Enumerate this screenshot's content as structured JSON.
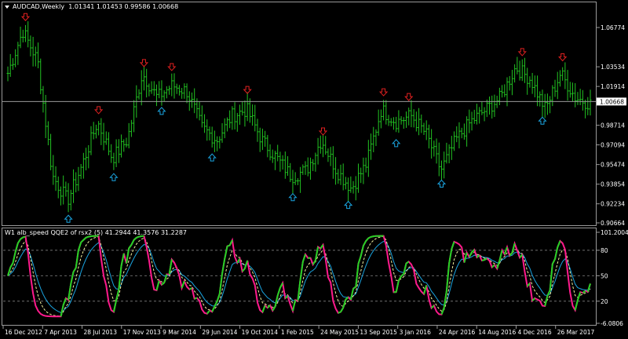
{
  "chart": {
    "symbol_label": "AUDCAD,Weekly",
    "ohlc_label": "1.01341 1.01453 0.99586 1.00668",
    "current_price": "1.00668",
    "price_ticks": [
      "1.06774",
      "1.03534",
      "1.01914",
      "0.98714",
      "0.97094",
      "0.95474",
      "0.93854",
      "0.92234",
      "0.90664"
    ],
    "date_ticks": [
      "16 Dec 2012",
      "7 Apr 2013",
      "28 Jul 2013",
      "17 Nov 2013",
      "9 Mar 2014",
      "29 Jun 2014",
      "19 Oct 2014",
      "1 Feb 2015",
      "24 May 2015",
      "13 Sep 2015",
      "3 Jan 2016",
      "24 Apr 2016",
      "14 Aug 2016",
      "4 Dec 2016",
      "26 Mar 2017"
    ]
  },
  "indicator": {
    "label": "W1 alb_speed QQE2 of rsx2 (5) 41.2944 41.3576 31.2287",
    "ticks": [
      "101.2004",
      "80",
      "50",
      "20",
      "-6.0806"
    ],
    "values": [
      41.2944,
      41.3576,
      31.2287
    ]
  },
  "colors": {
    "bar": "#22c322",
    "up_arrow": "#1aa4e0",
    "down_arrow": "#e02020",
    "qqe_fast": "#ff1a8c",
    "qqe_green": "#22d322",
    "qqe_slow": "#1aa4e0",
    "qqe_dash": "#f0f0a0",
    "grid": "#808080"
  },
  "chart_data": {
    "type": "bar",
    "title": "AUDCAD,Weekly",
    "x": [
      "16 Dec 2012",
      "7 Apr 2013",
      "28 Jul 2013",
      "17 Nov 2013",
      "9 Mar 2014",
      "29 Jun 2014",
      "19 Oct 2014",
      "1 Feb 2015",
      "24 May 2015",
      "13 Sep 2015",
      "3 Jan 2016",
      "24 Apr 2016",
      "14 Aug 2016",
      "4 Dec 2016",
      "26 Mar 2017"
    ],
    "ylim": [
      0.90664,
      1.08394
    ],
    "series": [
      {
        "values": [
          1.03,
          1.065,
          1.04,
          0.945,
          0.925,
          0.955,
          0.99,
          0.96,
          0.975,
          1.03,
          1.01,
          1.02,
          1.015,
          0.985,
          0.975,
          0.995,
          1.0,
          0.975,
          0.96,
          0.945,
          0.95,
          0.975,
          0.95,
          0.935,
          0.955,
          1.0,
          0.99,
          0.995,
          0.98,
          0.95,
          0.975,
          0.99,
          1.0,
          1.01,
          1.035,
          1.025,
          1.0,
          1.03,
          1.01,
          1.005
        ]
      }
    ]
  }
}
